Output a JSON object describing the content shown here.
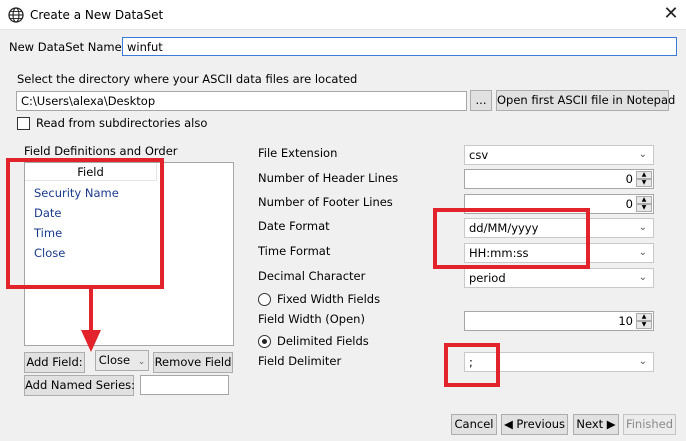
{
  "window": {
    "title": "Create a New DataSet",
    "close_glyph": "✕"
  },
  "dataset_name": {
    "label": "New DataSet Name:",
    "value": "winfut"
  },
  "directory": {
    "label": "Select the directory where your ASCII data files are located",
    "path": "C:\\Users\\alexa\\Desktop",
    "browse_label": "...",
    "open_notepad_label": "Open first ASCII file in Notepad",
    "subdirs_label": "Read from subdirectories also"
  },
  "fields": {
    "group_label": "Field Definitions and Order",
    "column_header": "Field",
    "items": [
      "Security Name",
      "Date",
      "Time",
      "Close"
    ],
    "add_field_label": "Add Field:",
    "field_select": "Close",
    "remove_field_label": "Remove Field",
    "add_named_series_label": "Add Named Series:",
    "named_series_value": ""
  },
  "settings": {
    "file_extension": {
      "label": "File Extension",
      "value": "csv"
    },
    "header_lines": {
      "label": "Number of Header Lines",
      "value": "0"
    },
    "footer_lines": {
      "label": "Number of Footer Lines",
      "value": "0"
    },
    "date_format": {
      "label": "Date Format",
      "value": "dd/MM/yyyy"
    },
    "time_format": {
      "label": "Time Format",
      "value": "HH:mm:ss"
    },
    "decimal_char": {
      "label": "Decimal Character",
      "value": "period"
    },
    "fixed_width": {
      "label": "Fixed Width Fields",
      "selected": false
    },
    "field_width": {
      "label": "Field Width (Open)",
      "value": "10"
    },
    "delimited": {
      "label": "Delimited Fields",
      "selected": true
    },
    "field_delimiter": {
      "label": "Field Delimiter",
      "value": ";"
    }
  },
  "footer": {
    "cancel_label": "Cancel",
    "previous_label": "◀ Previous",
    "next_label": "Next ▶",
    "finished_label": "Finished"
  },
  "colors": {
    "annotation": "#e3232b",
    "field_text": "#1a3a8c"
  }
}
